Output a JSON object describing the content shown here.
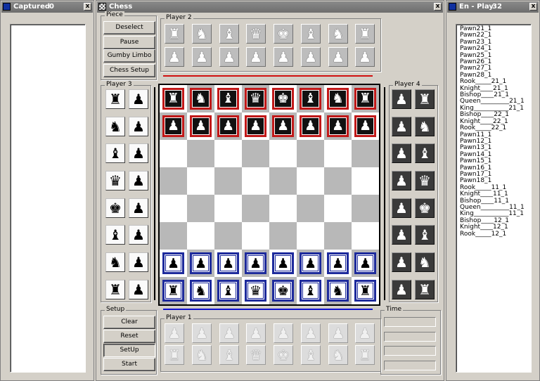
{
  "windows": {
    "captured": {
      "title": "Captured",
      "count": "0",
      "close": "x"
    },
    "chess": {
      "title": "Chess",
      "close": "x"
    },
    "enplay": {
      "title": "En - Play",
      "count": "32",
      "close": "x"
    }
  },
  "piece_group": {
    "label": "Piece",
    "buttons": [
      "Deselect",
      "Pause",
      "Gumby Limbo",
      "Chess Setup"
    ]
  },
  "setup_group": {
    "label": "Setup",
    "buttons": [
      "Clear",
      "Reset",
      "SetUp",
      "Start"
    ],
    "pressed": "SetUp"
  },
  "time_group": {
    "label": "Time"
  },
  "players": {
    "p1": {
      "label": "Player 1",
      "pieces": [
        "♟",
        "♟",
        "♟",
        "♟",
        "♟",
        "♟",
        "♟",
        "♟",
        "♜",
        "♞",
        "♝",
        "♛",
        "♚",
        "♝",
        "♞",
        "♜"
      ]
    },
    "p2": {
      "label": "Player 2",
      "pieces": [
        "♜",
        "♞",
        "♝",
        "♛",
        "♚",
        "♝",
        "♞",
        "♜",
        "♟",
        "♟",
        "♟",
        "♟",
        "♟",
        "♟",
        "♟",
        "♟"
      ]
    },
    "p3": {
      "label": "Player 3",
      "pieces": [
        "♜",
        "♟",
        "♞",
        "♟",
        "♝",
        "♟",
        "♛",
        "♟",
        "♚",
        "♟",
        "♝",
        "♟",
        "♞",
        "♟",
        "♜",
        "♟"
      ]
    },
    "p4": {
      "label": "Player 4",
      "pieces": [
        "♟",
        "♜",
        "♟",
        "♞",
        "♟",
        "♝",
        "♟",
        "♛",
        "♟",
        "♚",
        "♟",
        "♝",
        "♟",
        "♞",
        "♟",
        "♜"
      ]
    }
  },
  "board": {
    "rows": [
      {
        "color": "red",
        "pieces": [
          "♜",
          "♞",
          "♝",
          "♛",
          "♚",
          "♝",
          "♞",
          "♜"
        ]
      },
      {
        "color": "red",
        "pieces": [
          "♟",
          "♟",
          "♟",
          "♟",
          "♟",
          "♟",
          "♟",
          "♟"
        ]
      },
      {
        "color": "",
        "pieces": [
          "",
          "",
          "",
          "",
          "",
          "",
          "",
          ""
        ]
      },
      {
        "color": "",
        "pieces": [
          "",
          "",
          "",
          "",
          "",
          "",
          "",
          ""
        ]
      },
      {
        "color": "",
        "pieces": [
          "",
          "",
          "",
          "",
          "",
          "",
          "",
          ""
        ]
      },
      {
        "color": "",
        "pieces": [
          "",
          "",
          "",
          "",
          "",
          "",
          "",
          ""
        ]
      },
      {
        "color": "blue",
        "pieces": [
          "♟",
          "♟",
          "♟",
          "♟",
          "♟",
          "♟",
          "♟",
          "♟"
        ]
      },
      {
        "color": "blue",
        "pieces": [
          "♜",
          "♞",
          "♝",
          "♛",
          "♚",
          "♝",
          "♞",
          "♜"
        ]
      }
    ]
  },
  "enplay_list": [
    "Pawn21_1",
    "Pawn22_1",
    "Pawn23_1",
    "Pawn24_1",
    "Pawn25_1",
    "Pawn26_1",
    "Pawn27_1",
    "Pawn28_1",
    "Rook_____21_1",
    "Knight____21_1",
    "Bishop____21_1",
    "Queen_________21_1",
    "King___________21_1",
    "Bishop____22_1",
    "Knight____22_1",
    "Rook_____22_1",
    "Pawn11_1",
    "Pawn12_1",
    "Pawn13_1",
    "Pawn14_1",
    "Pawn15_1",
    "Pawn16_1",
    "Pawn17_1",
    "Pawn18_1",
    "Rook_____11_1",
    "Knight____11_1",
    "Bishop____11_1",
    "Queen_________11_1",
    "King___________11_1",
    "Bishop____12_1",
    "Knight____12_1",
    "Rook_____12_1"
  ]
}
